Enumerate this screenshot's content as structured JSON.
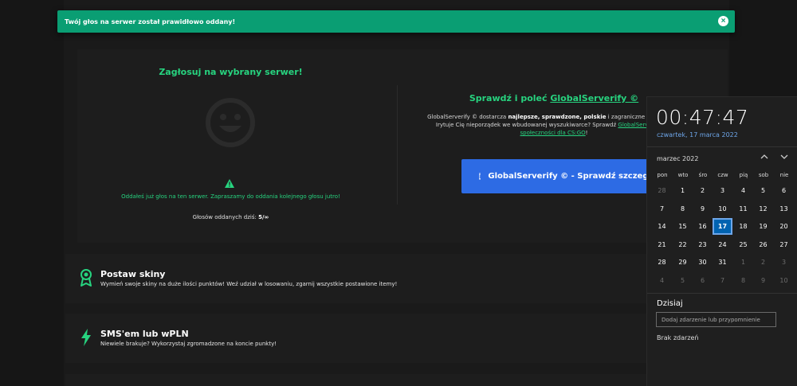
{
  "toast": {
    "message": "Twój głos na serwer został prawidłowo oddany!",
    "close_glyph": "×"
  },
  "vote": {
    "title": "Zagłosuj na wybrany serwer!",
    "already_voted_message": "Oddałeś już głos na ten serwer. Zapraszamy do oddania kolejnego głosu jutro!",
    "count_label": "Głosów oddanych dziś:",
    "count_value": "5/∞"
  },
  "recommend": {
    "title_prefix": "Sprawdź i poleć ",
    "title_link": "GlobalServerify ©",
    "desc_line1_a": "GlobalServerify © dostarcza ",
    "desc_line1_b": "najlepsze, sprawdzone, polskie",
    "desc_line1_c": " i zagraniczne serwery bez",
    "desc_line2_a": "Irytuje Cię nieporządek we wbudowanej wyszukiwarce? Sprawdź ",
    "desc_line2_link": "GlobalServerify ©",
    "desc_line2_b": " -",
    "desc_line3_link": "społeczności dla CS:GO",
    "desc_line3_b": "!",
    "button_label": "GlobalServerify © - Sprawdź szczegóły"
  },
  "features": [
    {
      "title": "Postaw skiny",
      "description": "Wymień swoje skiny na duże ilości punktów! Weź udział w losowaniu, zgarnij wszystkie postawione itemy!",
      "icon": "award-icon"
    },
    {
      "title": "SMS'em lub wPLN",
      "description": "Niewiele brakuje? Wykorzystaj zgromadzone na koncie punkty!",
      "icon": "lightning-icon"
    }
  ],
  "calendar": {
    "time": "00:47:47",
    "date_full": "czwartek, 17 marca 2022",
    "month_label": "marzec 2022",
    "weekdays": [
      "pon",
      "wto",
      "śro",
      "czw",
      "pią",
      "sob",
      "nie"
    ],
    "weeks": [
      [
        "28",
        "1",
        "2",
        "3",
        "4",
        "5",
        "6"
      ],
      [
        "7",
        "8",
        "9",
        "10",
        "11",
        "12",
        "13"
      ],
      [
        "14",
        "15",
        "16",
        "17",
        "18",
        "19",
        "20"
      ],
      [
        "21",
        "22",
        "23",
        "24",
        "25",
        "26",
        "27"
      ],
      [
        "28",
        "29",
        "30",
        "31",
        "1",
        "2",
        "3"
      ],
      [
        "4",
        "5",
        "6",
        "7",
        "8",
        "9",
        "10"
      ]
    ],
    "selected_day": "17",
    "today_title": "Dzisiaj",
    "event_placeholder": "Dodaj zdarzenie lub przypomnienie",
    "no_events": "Brak zdarzeń"
  },
  "colors": {
    "accent_green": "#27d37f",
    "toast_green": "#0a9e73",
    "button_blue": "#2d6be4",
    "calendar_selected": "#0063b1"
  }
}
